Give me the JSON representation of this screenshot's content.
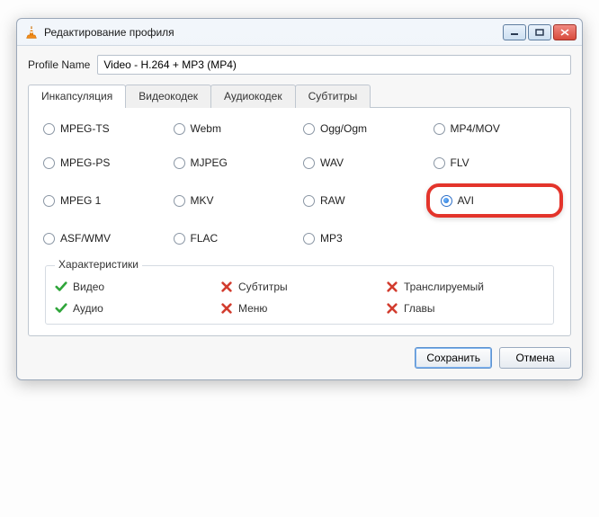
{
  "window": {
    "title": "Редактирование профиля"
  },
  "profile": {
    "name_label": "Profile Name",
    "name_value": "Video - H.264 + MP3 (MP4)"
  },
  "tabs": [
    {
      "id": "encapsulation",
      "label": "Инкапсуляция",
      "active": true
    },
    {
      "id": "videocodec",
      "label": "Видеокодек",
      "active": false
    },
    {
      "id": "audiocodec",
      "label": "Аудиокодек",
      "active": false
    },
    {
      "id": "subtitles",
      "label": "Субтитры",
      "active": false
    }
  ],
  "encap": {
    "options": [
      {
        "id": "mpeg-ts",
        "label": "MPEG-TS",
        "checked": false
      },
      {
        "id": "webm",
        "label": "Webm",
        "checked": false
      },
      {
        "id": "ogg",
        "label": "Ogg/Ogm",
        "checked": false
      },
      {
        "id": "mp4",
        "label": "MP4/MOV",
        "checked": false
      },
      {
        "id": "mpeg-ps",
        "label": "MPEG-PS",
        "checked": false
      },
      {
        "id": "mjpeg",
        "label": "MJPEG",
        "checked": false
      },
      {
        "id": "wav",
        "label": "WAV",
        "checked": false
      },
      {
        "id": "flv",
        "label": "FLV",
        "checked": false
      },
      {
        "id": "mpeg1",
        "label": "MPEG 1",
        "checked": false
      },
      {
        "id": "mkv",
        "label": "MKV",
        "checked": false
      },
      {
        "id": "raw",
        "label": "RAW",
        "checked": false
      },
      {
        "id": "avi",
        "label": "AVI",
        "checked": true,
        "highlight": true
      },
      {
        "id": "asf",
        "label": "ASF/WMV",
        "checked": false
      },
      {
        "id": "flac",
        "label": "FLAC",
        "checked": false
      },
      {
        "id": "mp3",
        "label": "MP3",
        "checked": false
      }
    ]
  },
  "features": {
    "title": "Характеристики",
    "items": [
      {
        "id": "video",
        "label": "Видео",
        "ok": true
      },
      {
        "id": "subtitles",
        "label": "Субтитры",
        "ok": false
      },
      {
        "id": "streamable",
        "label": "Транслируемый",
        "ok": false
      },
      {
        "id": "audio",
        "label": "Аудио",
        "ok": true
      },
      {
        "id": "menu",
        "label": "Меню",
        "ok": false
      },
      {
        "id": "chapters",
        "label": "Главы",
        "ok": false
      }
    ]
  },
  "buttons": {
    "save": "Сохранить",
    "cancel": "Отмена"
  },
  "colors": {
    "highlight": "#e3342b",
    "ok": "#2fa53a",
    "bad": "#d23c2e"
  }
}
